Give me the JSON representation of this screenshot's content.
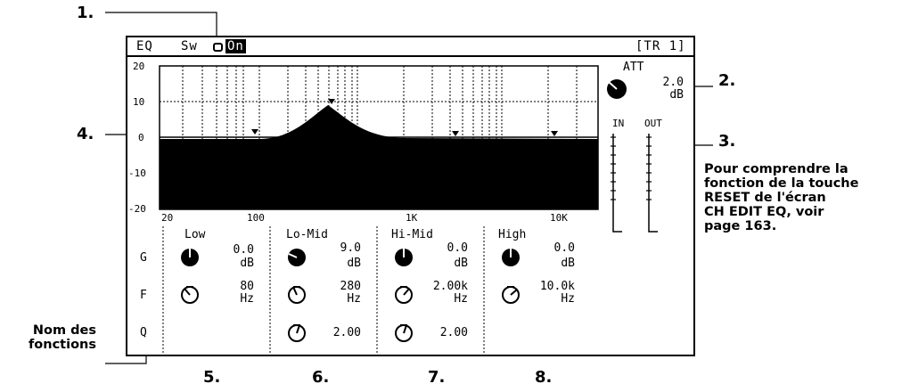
{
  "callouts": {
    "c1": "1.",
    "c2": "2.",
    "c3": "3.",
    "c4": "4.",
    "c5": "5.",
    "c6": "6.",
    "c7": "7.",
    "c8": "8."
  },
  "note": {
    "reset_line1": "Pour comprendre la",
    "reset_line2": "fonction de la touche",
    "reset_line3": "RESET de l'écran",
    "reset_line4": "CH EDIT EQ, voir",
    "reset_line5": "page 163.",
    "functions_line1": "Nom des",
    "functions_line2": "fonctions"
  },
  "screen": {
    "title": "EQ",
    "switch_label": "Sw",
    "switch_state": "On",
    "track": "[TR 1]",
    "att_label": "ATT",
    "att_value": "2.0",
    "att_unit": "dB",
    "meter_in": "IN",
    "meter_out": "OUT"
  },
  "graph": {
    "y_ticks": [
      "20",
      "10",
      "0",
      "-10",
      "-20"
    ],
    "x_ticks": [
      "20",
      "100",
      "1K",
      "10K"
    ]
  },
  "rows": {
    "g": "G",
    "f": "F",
    "q": "Q"
  },
  "bands": [
    {
      "name": "Low",
      "gain": "0.0",
      "gain_unit": "dB",
      "freq": "80",
      "freq_unit": "Hz",
      "q": ""
    },
    {
      "name": "Lo-Mid",
      "gain": "9.0",
      "gain_unit": "dB",
      "freq": "280",
      "freq_unit": "Hz",
      "q": "2.00"
    },
    {
      "name": "Hi-Mid",
      "gain": "0.0",
      "gain_unit": "dB",
      "freq": "2.00k",
      "freq_unit": "Hz",
      "q": "2.00"
    },
    {
      "name": "High",
      "gain": "0.0",
      "gain_unit": "dB",
      "freq": "10.0k",
      "freq_unit": "Hz",
      "q": ""
    }
  ]
}
